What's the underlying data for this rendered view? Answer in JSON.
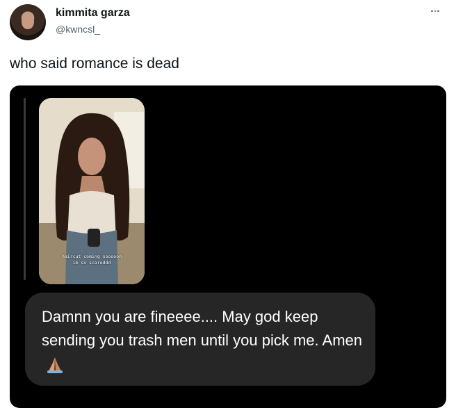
{
  "tweet": {
    "display_name": "kimmita garza",
    "handle": "@kwncsl_",
    "text": "who said romance is dead",
    "more_icon": "more-horizontal-icon"
  },
  "media": {
    "story_caption_line1": "haircut coming sooooon",
    "story_caption_line2": "im so scareddd",
    "message_text": "Damnn you are fineeee.... May god keep sending you trash men until you pick me. Amen",
    "message_emoji": "praying-hands-icon"
  },
  "colors": {
    "card_background": "#000000",
    "bubble_background": "#262626",
    "text_primary": "#0f1419",
    "text_secondary": "#536471"
  }
}
